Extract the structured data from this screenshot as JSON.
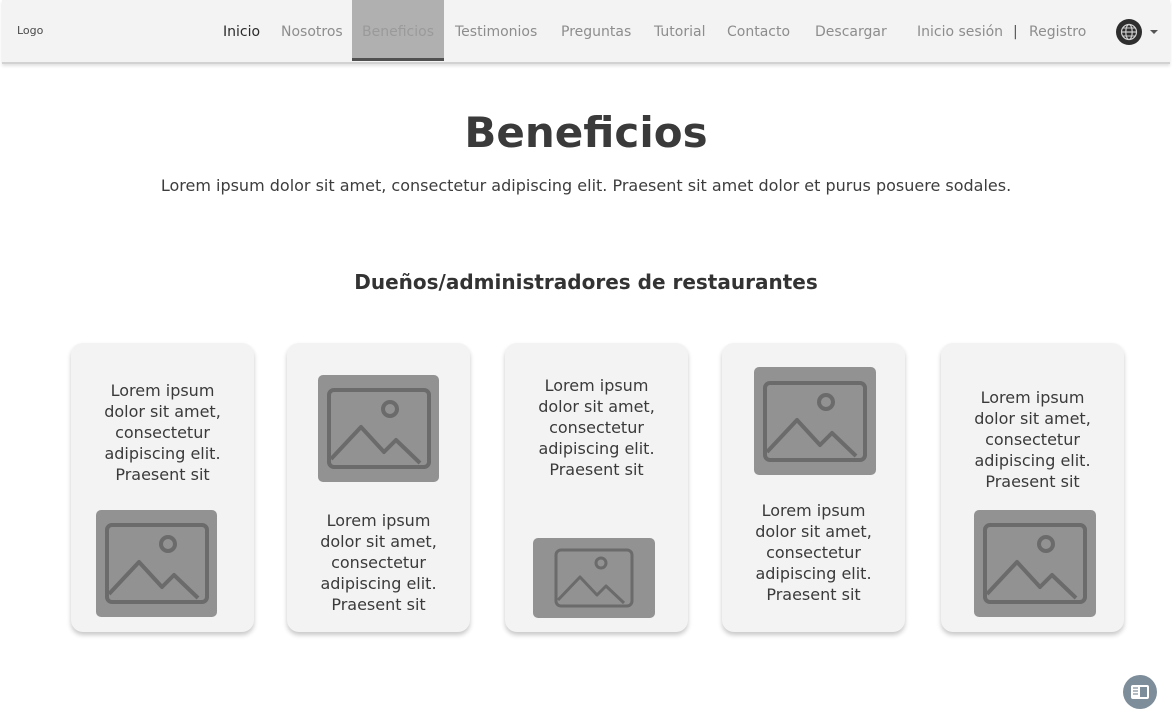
{
  "nav": {
    "logo": "Logo",
    "links": [
      "Inicio",
      "Nosotros",
      "Beneficios",
      "Testimonios",
      "Preguntas",
      "Tutorial",
      "Contacto",
      "Descargar"
    ],
    "login": "Inicio sesión",
    "separator": "|",
    "register": "Registro",
    "active": "Beneficios"
  },
  "hero": {
    "title": "Beneficios",
    "subtitle": "Lorem ipsum dolor sit amet, consectetur adipiscing elit. Praesent sit amet dolor et purus posuere sodales."
  },
  "section": {
    "title": "Dueños/administradores de restaurantes"
  },
  "cards": [
    {
      "text": "Lorem ipsum dolor sit amet, consectetur adipiscing elit. Praesent sit",
      "image": "image-placeholder-icon"
    },
    {
      "text": "Lorem ipsum dolor sit amet, consectetur adipiscing elit. Praesent sit",
      "image": "image-placeholder-icon"
    },
    {
      "text": "Lorem ipsum dolor sit amet, consectetur adipiscing elit. Praesent sit",
      "image": "image-placeholder-icon"
    },
    {
      "text": "Lorem ipsum dolor sit amet, consectetur adipiscing elit. Praesent sit",
      "image": "image-placeholder-icon"
    },
    {
      "text": "Lorem ipsum dolor sit amet, consectetur adipiscing elit. Praesent sit",
      "image": "image-placeholder-icon"
    }
  ],
  "icons": {
    "language": "globe-icon",
    "language_caret": "chevron-down-icon",
    "floating": "reader-mode-icon"
  },
  "colors": {
    "nav_bg": "#f3f3f3",
    "active_tab_bg": "#b0b0b0",
    "card_bg": "#f3f3f3",
    "image_placeholder": "#929292",
    "floating_button": "#7e8d9a"
  }
}
